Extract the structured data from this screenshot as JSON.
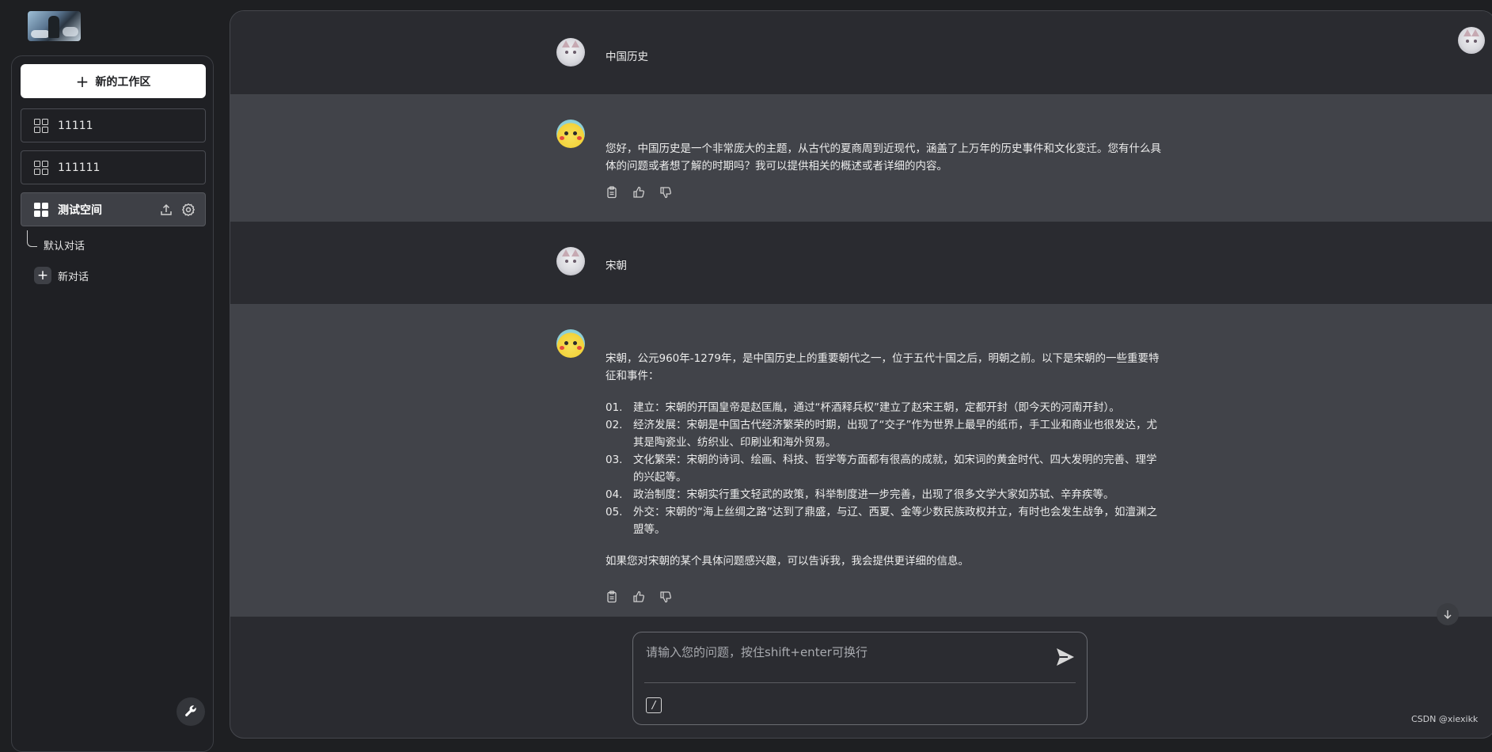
{
  "sidebar": {
    "new_workspace_label": "新的工作区",
    "workspaces": [
      {
        "label": "11111"
      },
      {
        "label": "111111"
      },
      {
        "label": "测试空间"
      }
    ],
    "default_conversation": "默认对话",
    "new_conversation_label": "新对话"
  },
  "messages": [
    {
      "role": "user",
      "text": "中国历史"
    },
    {
      "role": "assistant",
      "text": "您好，中国历史是一个非常庞大的主题，从古代的夏商周到近现代，涵盖了上万年的历史事件和文化变迁。您有什么具体的问题或者想了解的时期吗？我可以提供相关的概述或者详细的内容。"
    },
    {
      "role": "user",
      "text": "宋朝"
    },
    {
      "role": "assistant",
      "intro": "宋朝，公元960年-1279年，是中国历史上的重要朝代之一，位于五代十国之后，明朝之前。以下是宋朝的一些重要特征和事件：",
      "points": [
        {
          "num": "01.",
          "text": "建立：宋朝的开国皇帝是赵匡胤，通过“杯酒释兵权”建立了赵宋王朝，定都开封（即今天的河南开封）。"
        },
        {
          "num": "02.",
          "text": "经济发展：宋朝是中国古代经济繁荣的时期，出现了“交子”作为世界上最早的纸币，手工业和商业也很发达，尤其是陶瓷业、纺织业、印刷业和海外贸易。"
        },
        {
          "num": "03.",
          "text": "文化繁荣：宋朝的诗词、绘画、科技、哲学等方面都有很高的成就，如宋词的黄金时代、四大发明的完善、理学的兴起等。"
        },
        {
          "num": "04.",
          "text": "政治制度：宋朝实行重文轻武的政策，科举制度进一步完善，出现了很多文学大家如苏轼、辛弃疾等。"
        },
        {
          "num": "05.",
          "text": "外交：宋朝的“海上丝绸之路”达到了鼎盛，与辽、西夏、金等少数民族政权并立，有时也会发生战争，如澶渊之盟等。"
        }
      ],
      "outro": "如果您对宋朝的某个具体问题感兴趣，可以告诉我，我会提供更详细的信息。"
    }
  ],
  "composer": {
    "placeholder": "请输入您的问题，按住shift+enter可换行",
    "slash_label": "/"
  },
  "watermark": "CSDN @xiexikk",
  "icons": {
    "copy": "clipboard-icon",
    "like": "thumbs-up-icon",
    "dislike": "thumbs-down-icon",
    "send": "send-icon",
    "tools": "wrench-icon",
    "scroll": "arrow-down-icon"
  },
  "colors": {
    "background": "#1e1f22",
    "assistant_row": "#414349",
    "user_row": "#2a2b30",
    "new_workspace_button": "#ffffff"
  }
}
